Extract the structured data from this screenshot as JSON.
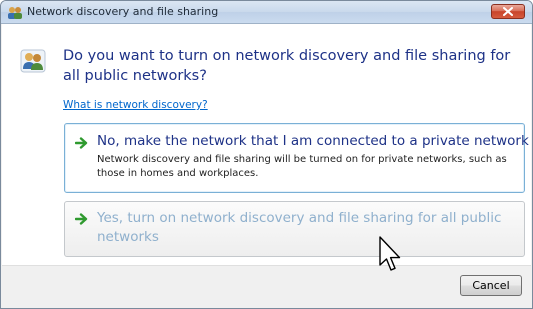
{
  "window": {
    "title": "Network discovery and file sharing",
    "close_icon": "close-icon"
  },
  "dialog": {
    "question": "Do you want to turn on network discovery and file sharing for all public networks?",
    "help_link": "What is network discovery?",
    "header_icon": "network-users-icon"
  },
  "options": [
    {
      "title": "No, make the network that I am connected to a private network",
      "description": "Network discovery and file sharing will be turned on for private networks, such as those in homes and workplaces.",
      "icon": "green-arrow-icon",
      "state": "highlighted"
    },
    {
      "title": "Yes, turn on network discovery and file sharing for all public networks",
      "icon": "green-arrow-icon",
      "state": "hovered"
    }
  ],
  "footer": {
    "cancel_label": "Cancel"
  },
  "colors": {
    "instruction_text": "#1e3287",
    "link": "#0066cc",
    "arrow": "#2f9a2f",
    "hover_text": "#8fb0cd"
  }
}
